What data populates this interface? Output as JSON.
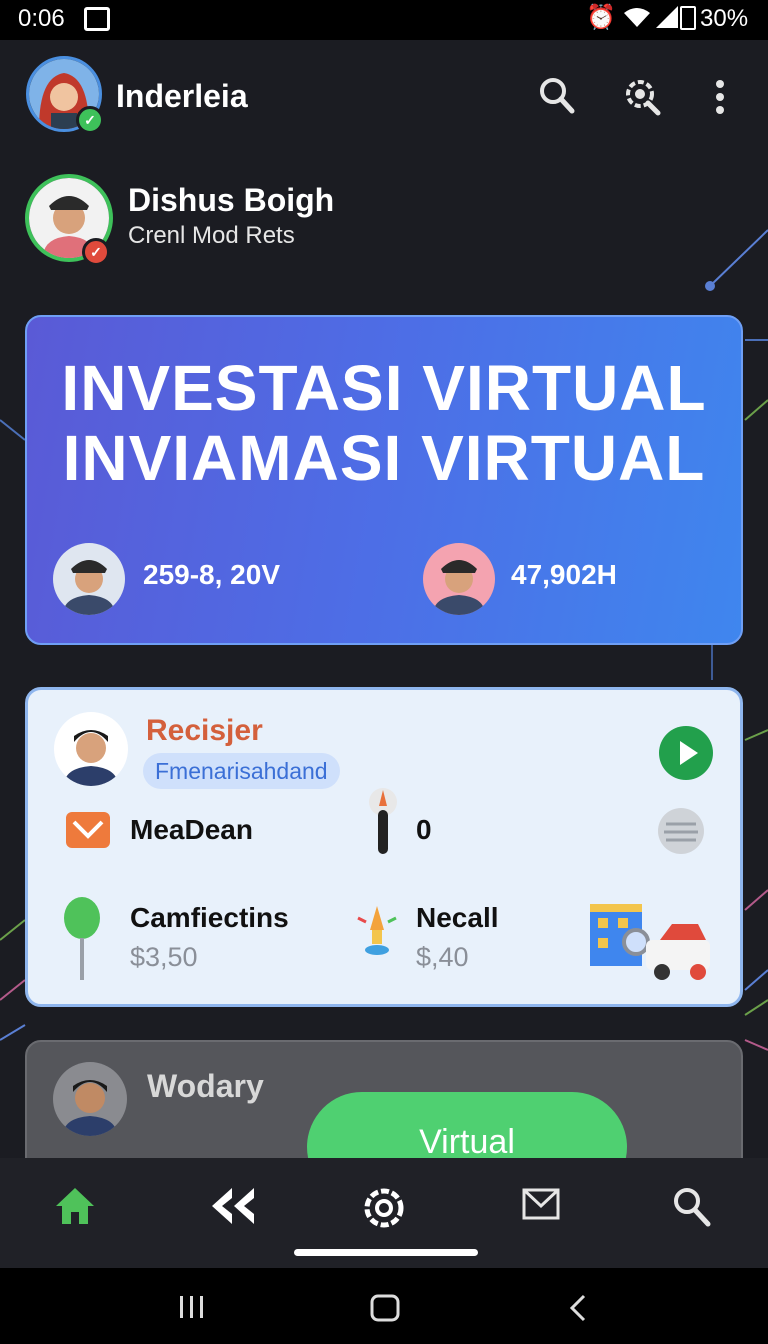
{
  "status_bar": {
    "time": "0:06",
    "battery": "30%"
  },
  "header": {
    "title": "Inderleia"
  },
  "profile": {
    "name": "Dishus Boigh",
    "subtitle": "Crenl Mod Rets"
  },
  "hero": {
    "line1": "INVESTASI VIRTUAL",
    "line2": "INVIAMASI VIRTUAL",
    "left_value": "259-8, 20V",
    "right_value": "47,902H"
  },
  "card1": {
    "title": "Recisjer",
    "chip": "Fmenarisahdand",
    "item1_label": "MeaDean",
    "item2_value": "0",
    "item3_label": "Camfiectins",
    "item3_value": "$3,50",
    "item4_label": "Necall",
    "item4_value": "$,40"
  },
  "card2": {
    "title": "Wodary",
    "button": "Virtual"
  },
  "colors": {
    "accent_blue": "#4d6ee6",
    "accent_green": "#4fd071",
    "card_title": "#d4603c",
    "background": "#1b1c22"
  }
}
